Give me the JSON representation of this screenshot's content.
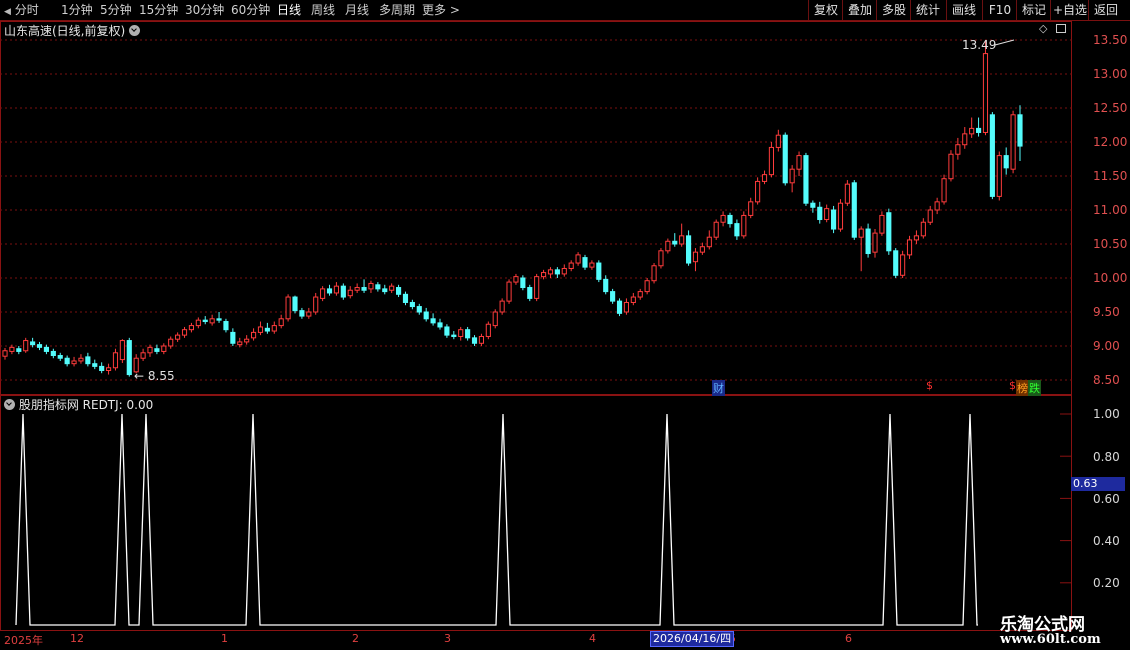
{
  "toolbar": {
    "periods": [
      "分时",
      "1分钟",
      "5分钟",
      "15分钟",
      "30分钟",
      "60分钟",
      "日线",
      "周线",
      "月线",
      "多周期",
      "更多"
    ],
    "active_period": "日线",
    "more_label": "更多",
    "right_buttons": [
      "复权",
      "叠加",
      "多股",
      "统计",
      "画线",
      "F10",
      "标记",
      "+自选",
      "返回"
    ]
  },
  "main_panel": {
    "title": "山东高速(日线,前复权)",
    "high_label": "13.49",
    "low_label": "8.55",
    "price_axis": [
      "13.50",
      "13.00",
      "12.50",
      "12.00",
      "11.50",
      "11.00",
      "10.50",
      "10.00",
      "9.50",
      "9.00",
      "8.50"
    ],
    "markers": [
      {
        "text": "财",
        "color": "#3fa0ff"
      },
      {
        "text": "$",
        "color": "#ff3030"
      },
      {
        "text": "$",
        "color": "#ff3030"
      },
      {
        "text": "榜",
        "color": "#ff8c00"
      },
      {
        "text": "跌",
        "color": "#20d020"
      }
    ]
  },
  "indicator_panel": {
    "title": "股朋指标网 REDTJ: 0.00",
    "axis": [
      "1.00",
      "0.80",
      "0.60",
      "0.40",
      "0.20"
    ],
    "current_value": "0.63"
  },
  "date_axis": {
    "labels": [
      "2025年",
      "12",
      "1",
      "2",
      "3",
      "4",
      "5",
      "6"
    ],
    "cursor_date": "2026/04/16/四"
  },
  "watermark": {
    "line1": "乐淘公式网",
    "line2": "www.60lt.com"
  },
  "colors": {
    "up": "#ff3c3c",
    "down": "#54fcfc",
    "grid": "#7a1010",
    "indicator": "#ffffff"
  },
  "chart_data": {
    "type": "candlestick",
    "ylim": [
      8.4,
      13.6
    ],
    "candles": [
      [
        8.85,
        8.93,
        8.8,
        8.97
      ],
      [
        8.92,
        8.98,
        8.88,
        9.02
      ],
      [
        8.96,
        8.92,
        8.88,
        9.0
      ],
      [
        8.93,
        9.08,
        8.9,
        9.12
      ],
      [
        9.06,
        9.02,
        8.98,
        9.12
      ],
      [
        9.02,
        8.98,
        8.94,
        9.06
      ],
      [
        8.98,
        8.92,
        8.88,
        9.02
      ],
      [
        8.92,
        8.86,
        8.82,
        8.96
      ],
      [
        8.86,
        8.82,
        8.78,
        8.9
      ],
      [
        8.82,
        8.74,
        8.7,
        8.86
      ],
      [
        8.74,
        8.78,
        8.7,
        8.84
      ],
      [
        8.78,
        8.82,
        8.74,
        8.88
      ],
      [
        8.84,
        8.74,
        8.7,
        8.9
      ],
      [
        8.74,
        8.7,
        8.66,
        8.8
      ],
      [
        8.7,
        8.64,
        8.6,
        8.76
      ],
      [
        8.64,
        8.68,
        8.58,
        8.74
      ],
      [
        8.68,
        8.9,
        8.64,
        8.96
      ],
      [
        8.8,
        9.08,
        8.75,
        9.1
      ],
      [
        9.08,
        8.58,
        8.55,
        9.12
      ],
      [
        8.62,
        8.82,
        8.6,
        8.88
      ],
      [
        8.82,
        8.9,
        8.78,
        8.96
      ],
      [
        8.9,
        8.98,
        8.84,
        9.02
      ],
      [
        8.96,
        8.92,
        8.88,
        9.02
      ],
      [
        8.92,
        9.0,
        8.88,
        9.04
      ],
      [
        9.0,
        9.1,
        8.96,
        9.14
      ],
      [
        9.1,
        9.16,
        9.06,
        9.2
      ],
      [
        9.16,
        9.24,
        9.12,
        9.28
      ],
      [
        9.24,
        9.3,
        9.2,
        9.34
      ],
      [
        9.3,
        9.38,
        9.26,
        9.42
      ],
      [
        9.38,
        9.36,
        9.32,
        9.44
      ],
      [
        9.34,
        9.4,
        9.3,
        9.46
      ],
      [
        9.4,
        9.38,
        9.34,
        9.5
      ],
      [
        9.36,
        9.24,
        9.2,
        9.4
      ],
      [
        9.2,
        9.04,
        9.0,
        9.26
      ],
      [
        9.02,
        9.06,
        8.98,
        9.12
      ],
      [
        9.06,
        9.1,
        9.02,
        9.16
      ],
      [
        9.12,
        9.2,
        9.08,
        9.26
      ],
      [
        9.2,
        9.28,
        9.16,
        9.36
      ],
      [
        9.26,
        9.22,
        9.18,
        9.34
      ],
      [
        9.22,
        9.3,
        9.18,
        9.36
      ],
      [
        9.3,
        9.4,
        9.26,
        9.46
      ],
      [
        9.4,
        9.72,
        9.36,
        9.76
      ],
      [
        9.72,
        9.52,
        9.48,
        9.74
      ],
      [
        9.52,
        9.44,
        9.4,
        9.56
      ],
      [
        9.44,
        9.5,
        9.4,
        9.56
      ],
      [
        9.5,
        9.72,
        9.46,
        9.78
      ],
      [
        9.7,
        9.84,
        9.66,
        9.88
      ],
      [
        9.84,
        9.78,
        9.74,
        9.9
      ],
      [
        9.78,
        9.88,
        9.74,
        9.94
      ],
      [
        9.88,
        9.72,
        9.68,
        9.92
      ],
      [
        9.74,
        9.82,
        9.7,
        9.88
      ],
      [
        9.82,
        9.86,
        9.78,
        9.92
      ],
      [
        9.86,
        9.82,
        9.78,
        9.98
      ],
      [
        9.84,
        9.92,
        9.78,
        9.96
      ],
      [
        9.9,
        9.84,
        9.8,
        9.94
      ],
      [
        9.84,
        9.8,
        9.76,
        9.9
      ],
      [
        9.82,
        9.88,
        9.78,
        9.92
      ],
      [
        9.86,
        9.76,
        9.72,
        9.9
      ],
      [
        9.76,
        9.64,
        9.6,
        9.8
      ],
      [
        9.64,
        9.58,
        9.54,
        9.68
      ],
      [
        9.58,
        9.5,
        9.46,
        9.62
      ],
      [
        9.5,
        9.4,
        9.36,
        9.56
      ],
      [
        9.4,
        9.34,
        9.3,
        9.48
      ],
      [
        9.34,
        9.28,
        9.24,
        9.4
      ],
      [
        9.28,
        9.16,
        9.12,
        9.32
      ],
      [
        9.16,
        9.14,
        9.1,
        9.22
      ],
      [
        9.14,
        9.24,
        9.08,
        9.28
      ],
      [
        9.24,
        9.12,
        9.08,
        9.28
      ],
      [
        9.12,
        9.04,
        9.0,
        9.16
      ],
      [
        9.04,
        9.14,
        9.0,
        9.18
      ],
      [
        9.14,
        9.32,
        9.1,
        9.36
      ],
      [
        9.3,
        9.5,
        9.26,
        9.54
      ],
      [
        9.5,
        9.66,
        9.46,
        9.7
      ],
      [
        9.66,
        9.94,
        9.62,
        9.98
      ],
      [
        9.94,
        10.02,
        9.9,
        10.06
      ],
      [
        10.0,
        9.86,
        9.82,
        10.04
      ],
      [
        9.86,
        9.7,
        9.66,
        9.9
      ],
      [
        9.7,
        10.02,
        9.66,
        10.06
      ],
      [
        10.02,
        10.08,
        9.98,
        10.12
      ],
      [
        10.06,
        10.12,
        10.0,
        10.16
      ],
      [
        10.12,
        10.06,
        10.0,
        10.16
      ],
      [
        10.06,
        10.14,
        10.02,
        10.2
      ],
      [
        10.14,
        10.22,
        10.1,
        10.26
      ],
      [
        10.22,
        10.34,
        10.18,
        10.38
      ],
      [
        10.3,
        10.16,
        10.12,
        10.34
      ],
      [
        10.16,
        10.22,
        10.12,
        10.26
      ],
      [
        10.22,
        9.98,
        9.94,
        10.26
      ],
      [
        9.98,
        9.8,
        9.76,
        10.04
      ],
      [
        9.8,
        9.66,
        9.62,
        9.84
      ],
      [
        9.66,
        9.48,
        9.44,
        9.7
      ],
      [
        9.5,
        9.64,
        9.46,
        9.7
      ],
      [
        9.64,
        9.72,
        9.6,
        9.78
      ],
      [
        9.72,
        9.8,
        9.68,
        9.84
      ],
      [
        9.8,
        9.96,
        9.76,
        10.0
      ],
      [
        9.96,
        10.18,
        9.92,
        10.22
      ],
      [
        10.18,
        10.4,
        10.14,
        10.44
      ],
      [
        10.4,
        10.54,
        10.36,
        10.58
      ],
      [
        10.54,
        10.5,
        10.46,
        10.66
      ],
      [
        10.5,
        10.62,
        10.46,
        10.8
      ],
      [
        10.62,
        10.22,
        10.18,
        10.7
      ],
      [
        10.24,
        10.38,
        10.1,
        10.44
      ],
      [
        10.38,
        10.46,
        10.34,
        10.52
      ],
      [
        10.46,
        10.6,
        10.42,
        10.7
      ],
      [
        10.6,
        10.82,
        10.56,
        10.86
      ],
      [
        10.82,
        10.92,
        10.76,
        10.98
      ],
      [
        10.92,
        10.8,
        10.74,
        10.96
      ],
      [
        10.8,
        10.62,
        10.56,
        10.86
      ],
      [
        10.62,
        10.92,
        10.58,
        10.98
      ],
      [
        10.92,
        11.12,
        10.88,
        11.18
      ],
      [
        11.12,
        11.42,
        11.08,
        11.48
      ],
      [
        11.42,
        11.52,
        11.38,
        11.58
      ],
      [
        11.52,
        11.92,
        11.48,
        12.0
      ],
      [
        11.92,
        12.1,
        11.86,
        12.18
      ],
      [
        12.1,
        11.4,
        11.36,
        12.14
      ],
      [
        11.4,
        11.6,
        11.26,
        11.66
      ],
      [
        11.6,
        11.8,
        11.5,
        11.86
      ],
      [
        11.8,
        11.1,
        11.06,
        11.84
      ],
      [
        11.1,
        11.04,
        10.96,
        11.14
      ],
      [
        11.04,
        10.86,
        10.8,
        11.12
      ],
      [
        10.86,
        11.02,
        10.82,
        11.08
      ],
      [
        11.0,
        10.72,
        10.66,
        11.06
      ],
      [
        10.72,
        11.1,
        10.68,
        11.16
      ],
      [
        11.1,
        11.38,
        11.06,
        11.44
      ],
      [
        11.4,
        10.6,
        10.56,
        11.44
      ],
      [
        10.6,
        10.72,
        10.1,
        10.76
      ],
      [
        10.72,
        10.36,
        10.3,
        10.8
      ],
      [
        10.38,
        10.66,
        10.3,
        10.72
      ],
      [
        10.66,
        10.92,
        10.62,
        10.98
      ],
      [
        10.96,
        10.4,
        10.34,
        11.02
      ],
      [
        10.4,
        10.04,
        10.0,
        10.44
      ],
      [
        10.04,
        10.34,
        10.0,
        10.4
      ],
      [
        10.34,
        10.56,
        10.28,
        10.62
      ],
      [
        10.56,
        10.62,
        10.5,
        10.7
      ],
      [
        10.62,
        10.82,
        10.58,
        10.88
      ],
      [
        10.82,
        11.0,
        10.78,
        11.06
      ],
      [
        11.0,
        11.12,
        10.94,
        11.18
      ],
      [
        11.12,
        11.46,
        11.08,
        11.52
      ],
      [
        11.46,
        11.82,
        11.42,
        11.88
      ],
      [
        11.82,
        11.96,
        11.74,
        12.06
      ],
      [
        11.96,
        12.12,
        11.9,
        12.22
      ],
      [
        12.12,
        12.2,
        12.06,
        12.36
      ],
      [
        12.2,
        12.14,
        12.08,
        12.36
      ],
      [
        12.14,
        13.3,
        12.1,
        13.49
      ],
      [
        12.4,
        11.2,
        11.16,
        12.44
      ],
      [
        11.2,
        11.8,
        11.14,
        11.86
      ],
      [
        11.8,
        11.62,
        11.52,
        11.92
      ],
      [
        11.6,
        12.4,
        11.54,
        12.46
      ],
      [
        12.4,
        11.94,
        11.72,
        12.54
      ]
    ],
    "indicator_peaks": [
      23,
      122,
      146,
      253,
      503,
      667,
      890,
      970
    ],
    "indicator_ylim": [
      0,
      1.05
    ]
  }
}
